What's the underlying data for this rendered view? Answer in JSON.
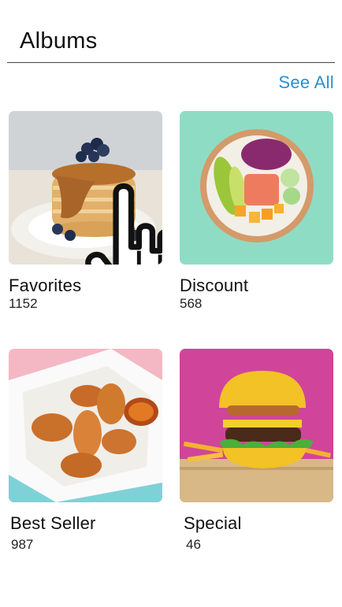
{
  "header": {
    "title": "Albums"
  },
  "actions": {
    "see_all_label": "See All"
  },
  "albums": [
    {
      "title": "Favorites",
      "count": "1152"
    },
    {
      "title": "Discount",
      "count": "568"
    },
    {
      "title": "Best Seller",
      "count": "987"
    },
    {
      "title": "Special",
      "count": "46"
    }
  ],
  "colors": {
    "accent": "#2a8fd2"
  },
  "icons": {
    "cursor": "hand-pointer-icon"
  }
}
